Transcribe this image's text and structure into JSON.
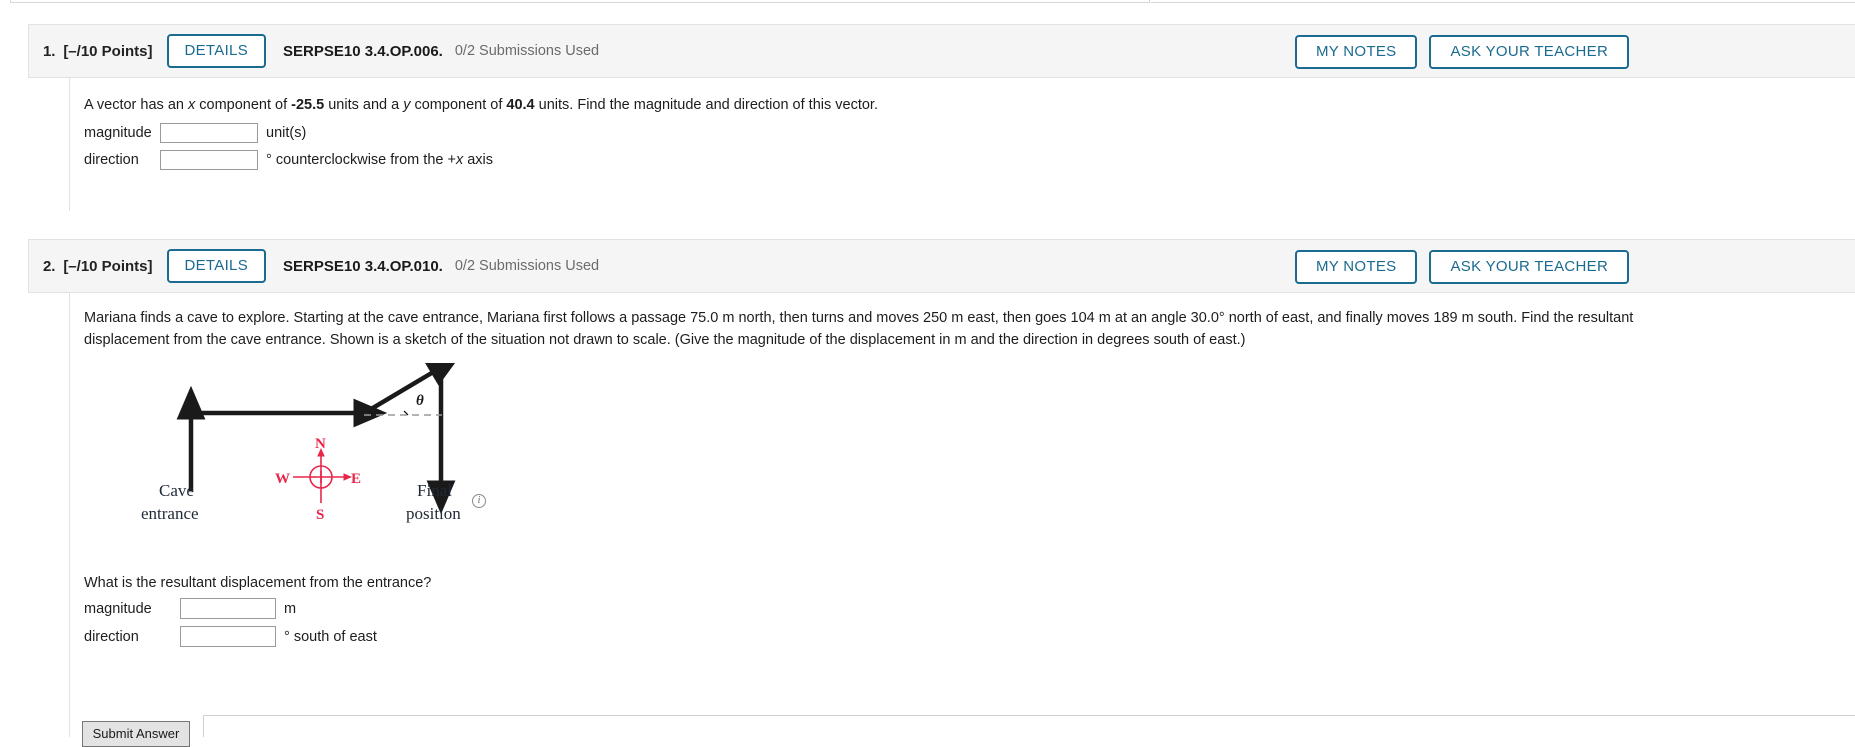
{
  "questions": [
    {
      "number": "1.",
      "points": "[–/10 Points]",
      "details_label": "DETAILS",
      "code": "SERPSE10 3.4.OP.006.",
      "submissions": "0/2 Submissions Used",
      "my_notes_label": "MY NOTES",
      "ask_teacher_label": "ASK YOUR TEACHER",
      "prompt": {
        "part1": "A vector has an ",
        "var_x": "x",
        "part2": " component of ",
        "value_x": "-25.5",
        "part3": " units and a ",
        "var_y": "y",
        "part4": " component of ",
        "value_y": "40.4",
        "part5": " units. Find the magnitude and direction of this vector."
      },
      "answers": [
        {
          "label": "magnitude",
          "value": "",
          "unit": "unit(s)"
        },
        {
          "label": "direction",
          "value": "",
          "unit_pre": "° counterclockwise from the +",
          "unit_var": "x",
          "unit_post": " axis"
        }
      ]
    },
    {
      "number": "2.",
      "points": "[–/10 Points]",
      "details_label": "DETAILS",
      "code": "SERPSE10 3.4.OP.010.",
      "submissions": "0/2 Submissions Used",
      "my_notes_label": "MY NOTES",
      "ask_teacher_label": "ASK YOUR TEACHER",
      "prompt_line1": "Mariana finds a cave to explore. Starting at the cave entrance, Mariana first follows a passage 75.0 m north, then turns and moves 250 m east, then goes 104 m at an angle 30.0° north of east, and finally moves 189 m south. Find the resultant",
      "prompt_line2": "displacement from the cave entrance. Shown is a sketch of the situation not drawn to scale. (Give the magnitude of the displacement in m and the direction in degrees south of east.)",
      "sub_question": "What is the resultant displacement from the entrance?",
      "answers": [
        {
          "label": "magnitude",
          "value": "",
          "unit": "m"
        },
        {
          "label": "direction",
          "value": "",
          "unit": "° south of east"
        }
      ],
      "figure": {
        "labels": {
          "theta": "θ",
          "cave_line1": "Cave",
          "cave_line2": "entrance",
          "final_line1": "Final",
          "final_line2": "position",
          "north": "N",
          "south": "S",
          "east": "E",
          "west": "W"
        },
        "compass_color": "#e8264a",
        "arrow_color": "#1a1a1a",
        "info_icon_glyph": "i"
      }
    }
  ],
  "footer": {
    "submit_label": "Submit Answer"
  }
}
